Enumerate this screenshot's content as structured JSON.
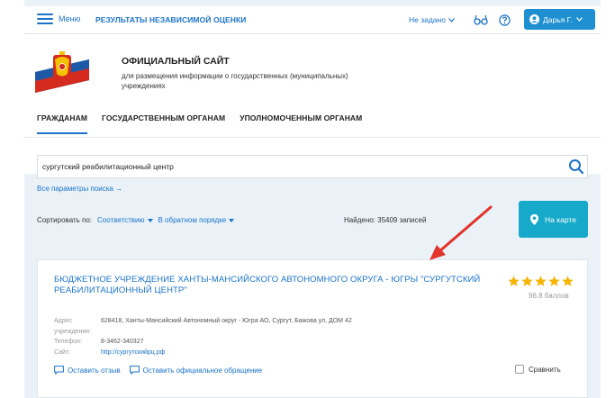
{
  "topbar": {
    "menu_label": "Меню",
    "results_link": "РЕЗУЛЬТАТЫ НЕЗАВИСИМОЙ ОЦЕНКИ",
    "region": "Не задано",
    "user": "Дарья Г."
  },
  "header": {
    "title": "ОФИЦИАЛЬНЫЙ САЙТ",
    "subtitle": "для размещения информации о государственных (муниципальных) учреждениях",
    "nav": [
      "ГРАЖДАНАМ",
      "ГОСУДАРСТВЕННЫМ ОРГАНАМ",
      "УПОЛНОМОЧЕННЫМ ОРГАНАМ"
    ]
  },
  "search": {
    "value": "сургутский реабилитационный центр",
    "all_params": "Все параметры поиска →"
  },
  "sort": {
    "label": "Сортировать по:",
    "option1": "Соответствию",
    "option2": "В обратном порядке",
    "found": "Найдено: 35409 записей",
    "map_button": "На карте"
  },
  "result": {
    "title": "БЮДЖЕТНОЕ УЧРЕЖДЕНИЕ ХАНТЫ-МАНСИЙСКОГО АВТОНОМНОГО ОКРУГА - ЮГРЫ \"СУРГУТСКИЙ РЕАБИЛИТАЦИОННЫЙ ЦЕНТР\"",
    "rating_stars": 5,
    "score": "96.8 баллов",
    "address_label": "Адрес учреждения:",
    "address": "628418, Ханты-Мансийский Автономный округ - Югра АО, Сургут, Бажова ул, ДОМ 42",
    "phone_label": "Телефон:",
    "phone": "8-3462-340327",
    "site_label": "Сайт:",
    "site": "http://сургутскийрц.рф",
    "review": "Оставить отзыв",
    "appeal": "Оставить официальное обращение",
    "compare": "Сравнить"
  },
  "colors": {
    "accent": "#1a73c8",
    "map_button": "#16a9c9",
    "star": "#f5b400",
    "arrow": "#e2342b"
  }
}
